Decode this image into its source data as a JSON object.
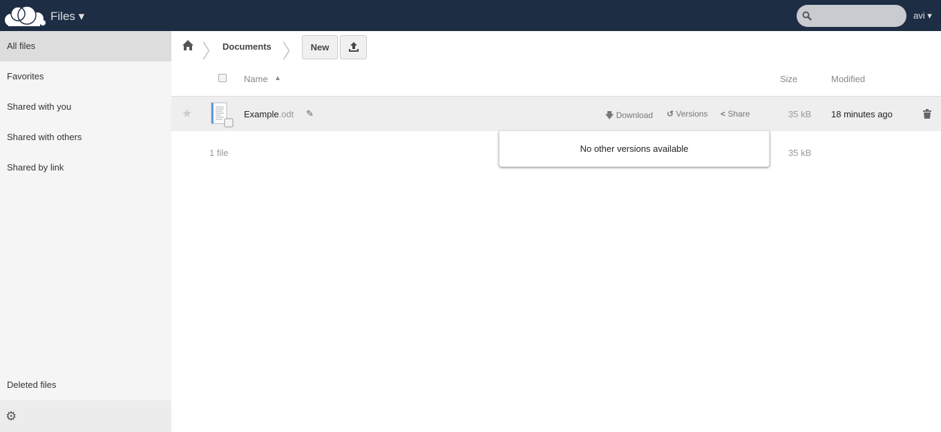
{
  "header": {
    "app_title": "Files ▾",
    "user": "avi ▾",
    "search_placeholder": ""
  },
  "sidebar": {
    "items": [
      {
        "label": "All files"
      },
      {
        "label": "Favorites"
      },
      {
        "label": "Shared with you"
      },
      {
        "label": "Shared with others"
      },
      {
        "label": "Shared by link"
      }
    ],
    "deleted": "Deleted files"
  },
  "breadcrumb": {
    "current": "Documents"
  },
  "toolbar": {
    "new_label": "New"
  },
  "table": {
    "headers": {
      "name": "Name",
      "sort": "▲",
      "size": "Size",
      "modified": "Modified"
    },
    "files": [
      {
        "base": "Example",
        "ext": ".odt",
        "size": "35 kB",
        "modified": "18 minutes ago",
        "actions": {
          "download": "Download",
          "versions": "Versions",
          "share": "Share"
        }
      }
    ],
    "summary": {
      "count": "1 file",
      "size": "35 kB"
    }
  },
  "popover": {
    "text": "No other versions available"
  }
}
